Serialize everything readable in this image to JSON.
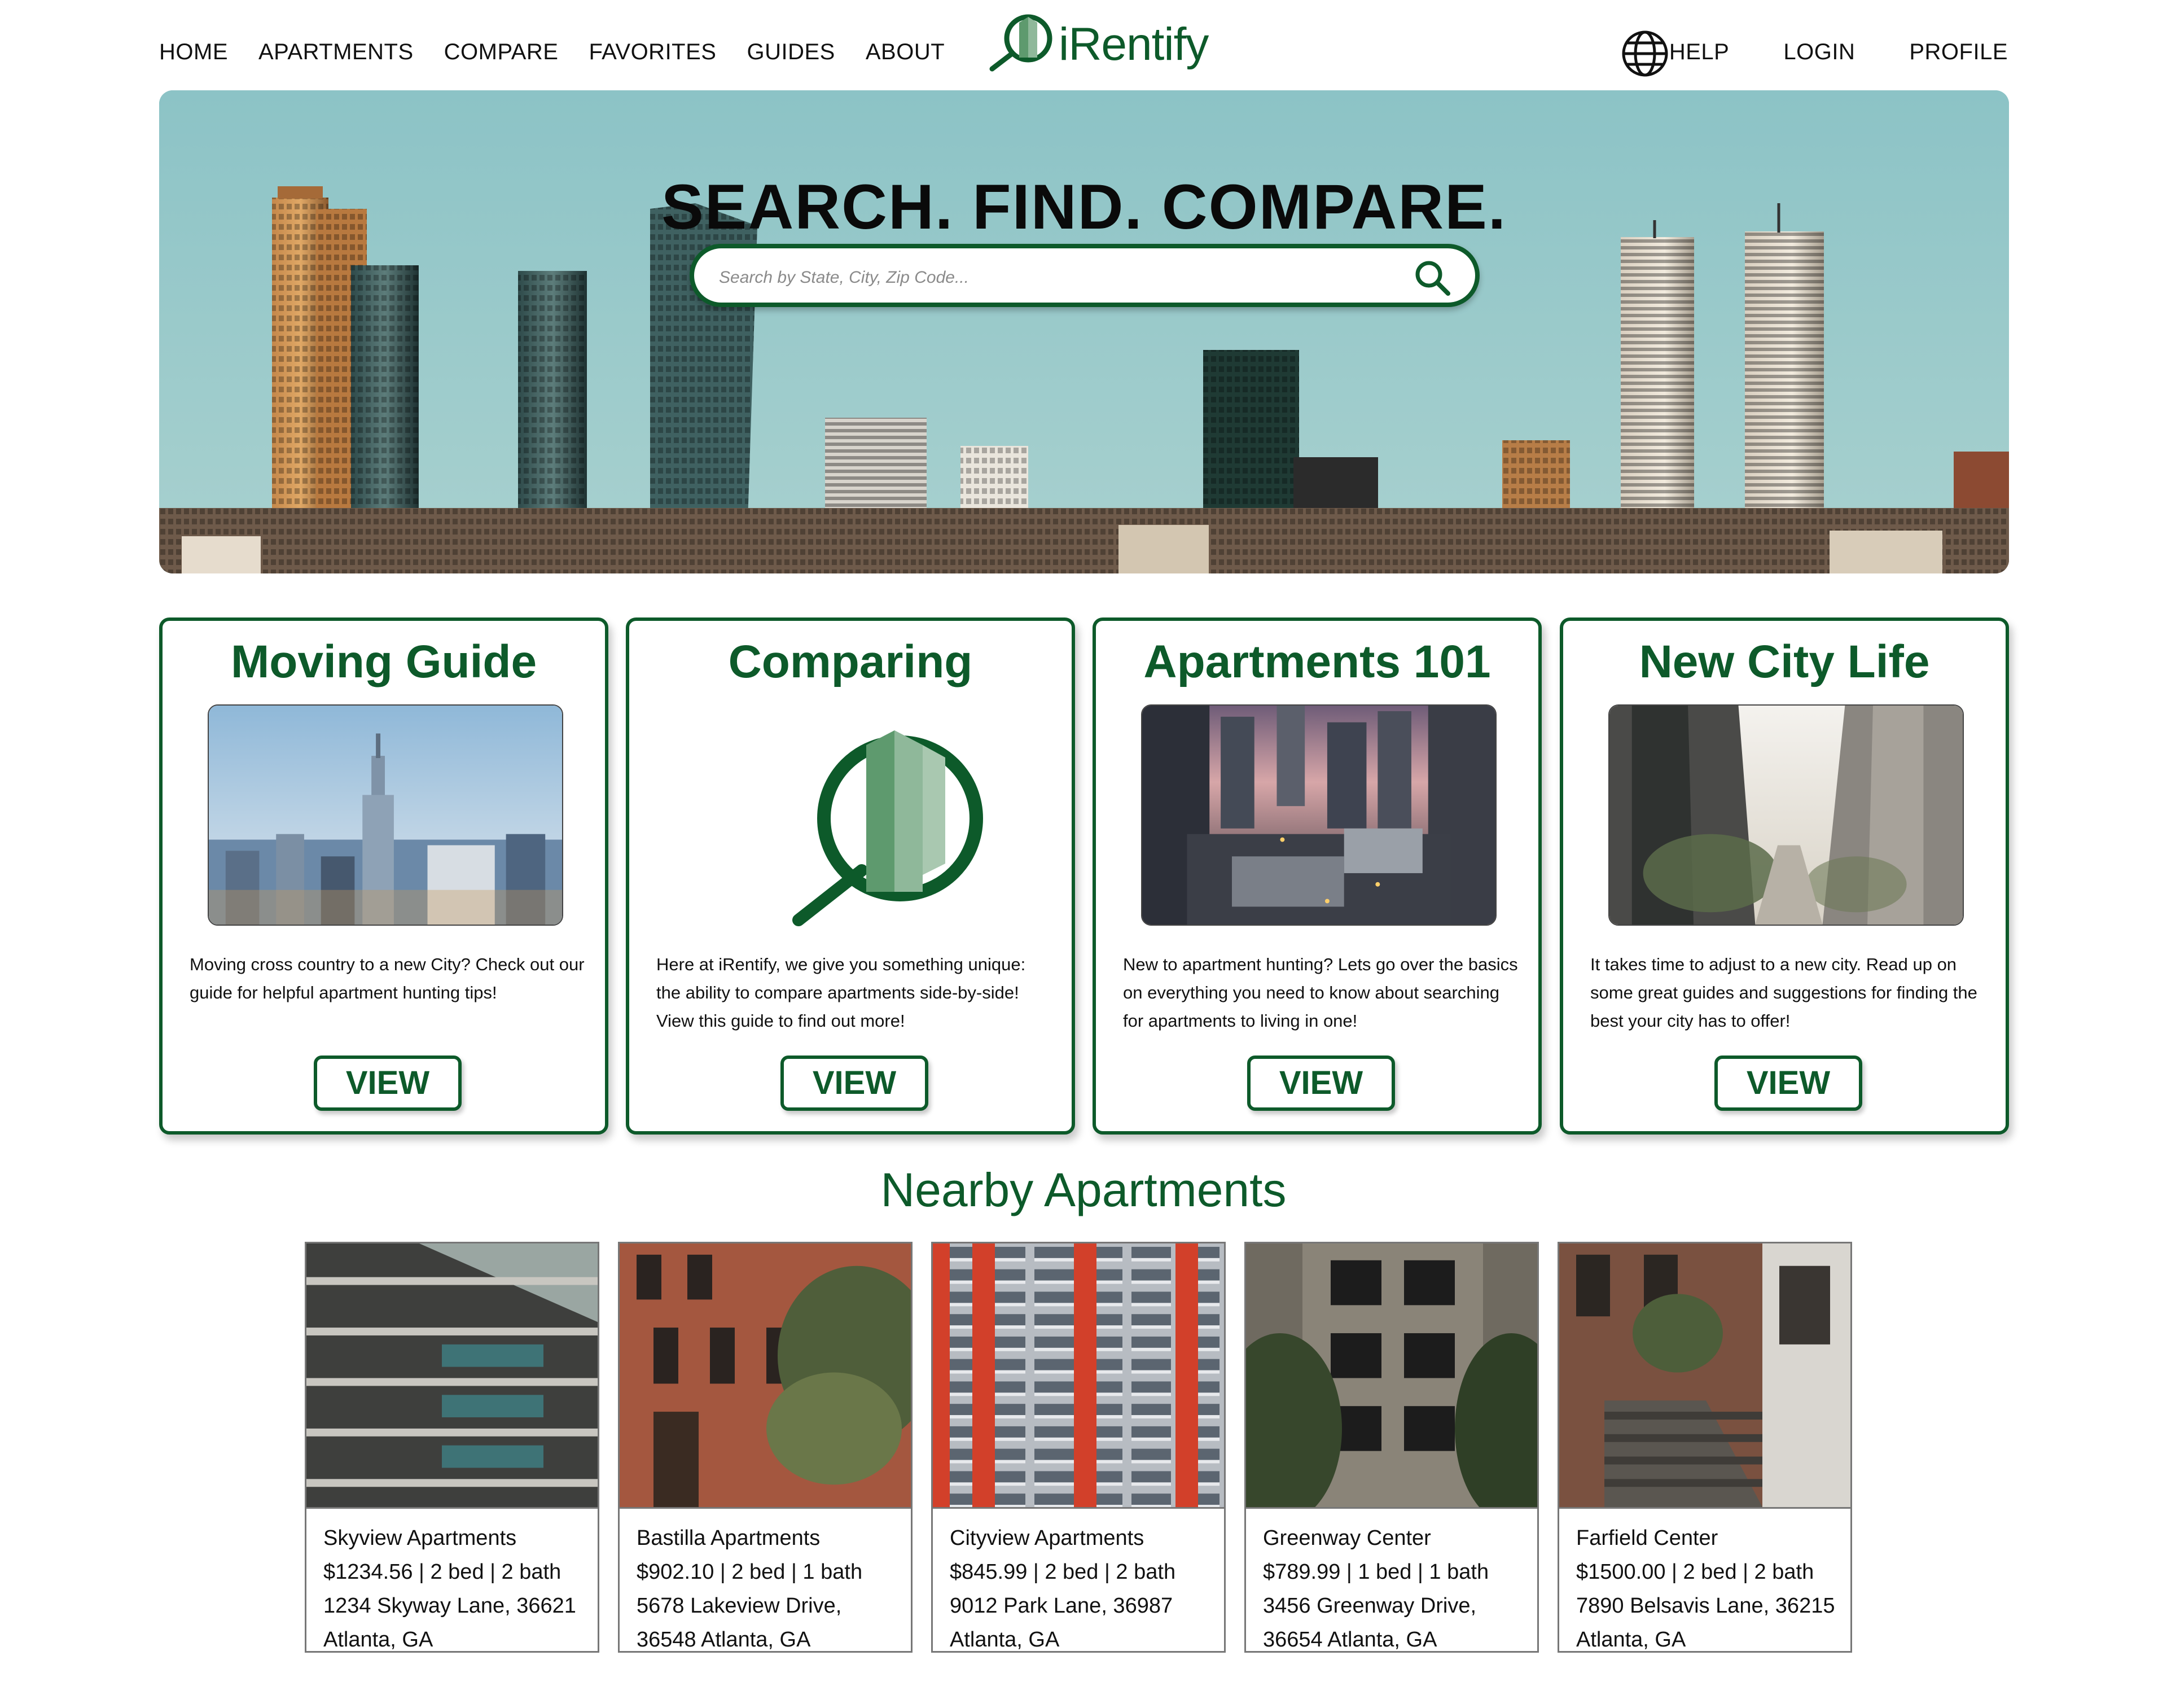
{
  "nav": {
    "left": [
      "HOME",
      "APARTMENTS",
      "COMPARE",
      "FAVORITES",
      "GUIDES",
      "ABOUT"
    ],
    "right": [
      "HELP",
      "LOGIN",
      "PROFILE"
    ],
    "globe_icon": "globe-icon"
  },
  "logo": {
    "text": "iRentify",
    "icon": "magnifier-building-icon"
  },
  "hero": {
    "title": "SEARCH. FIND. COMPARE.",
    "search_placeholder": "Search by State, City, Zip Code...",
    "search_icon": "search-icon"
  },
  "guides": [
    {
      "title": "Moving Guide",
      "text": "Moving cross country to a new City? Check out our guide for helpful apartment hunting tips!",
      "button": "VIEW"
    },
    {
      "title": "Comparing",
      "text": "Here at iRentify, we give you something unique: the ability to compare apartments side-by-side! View this guide to find out more!",
      "button": "VIEW"
    },
    {
      "title": "Apartments 101",
      "text": "New to apartment hunting? Lets go over the basics on everything you need to know about searching for apartments to living in one!",
      "button": "VIEW"
    },
    {
      "title": "New City Life",
      "text": "It takes time to adjust to a new city. Read up on some great guides and suggestions for finding the best your city has to offer!",
      "button": "VIEW"
    }
  ],
  "nearby": {
    "title": "Nearby Apartments",
    "items": [
      {
        "name": "Skyview Apartments",
        "details": "$1234.56 | 2 bed | 2 bath",
        "address1": "1234 Skyway Lane, 36621",
        "address2": "Atlanta, GA"
      },
      {
        "name": "Bastilla Apartments",
        "details": "$902.10 | 2 bed | 1 bath",
        "address1": "5678 Lakeview Drive,",
        "address2": "36548 Atlanta, GA"
      },
      {
        "name": "Cityview Apartments",
        "details": "$845.99 | 2 bed | 2 bath",
        "address1": "9012 Park Lane, 36987",
        "address2": "Atlanta, GA"
      },
      {
        "name": "Greenway Center",
        "details": "$789.99 | 1 bed | 1 bath",
        "address1": "3456 Greenway Drive,",
        "address2": "36654 Atlanta, GA"
      },
      {
        "name": "Farfield Center",
        "details": "$1500.00 | 2 bed | 2 bath",
        "address1": "7890 Belsavis Lane, 36215",
        "address2": "Atlanta, GA"
      }
    ]
  },
  "colors": {
    "brand_green": "#0d5a2a",
    "sky": "#8fc4c5",
    "border_gray": "#777777"
  }
}
